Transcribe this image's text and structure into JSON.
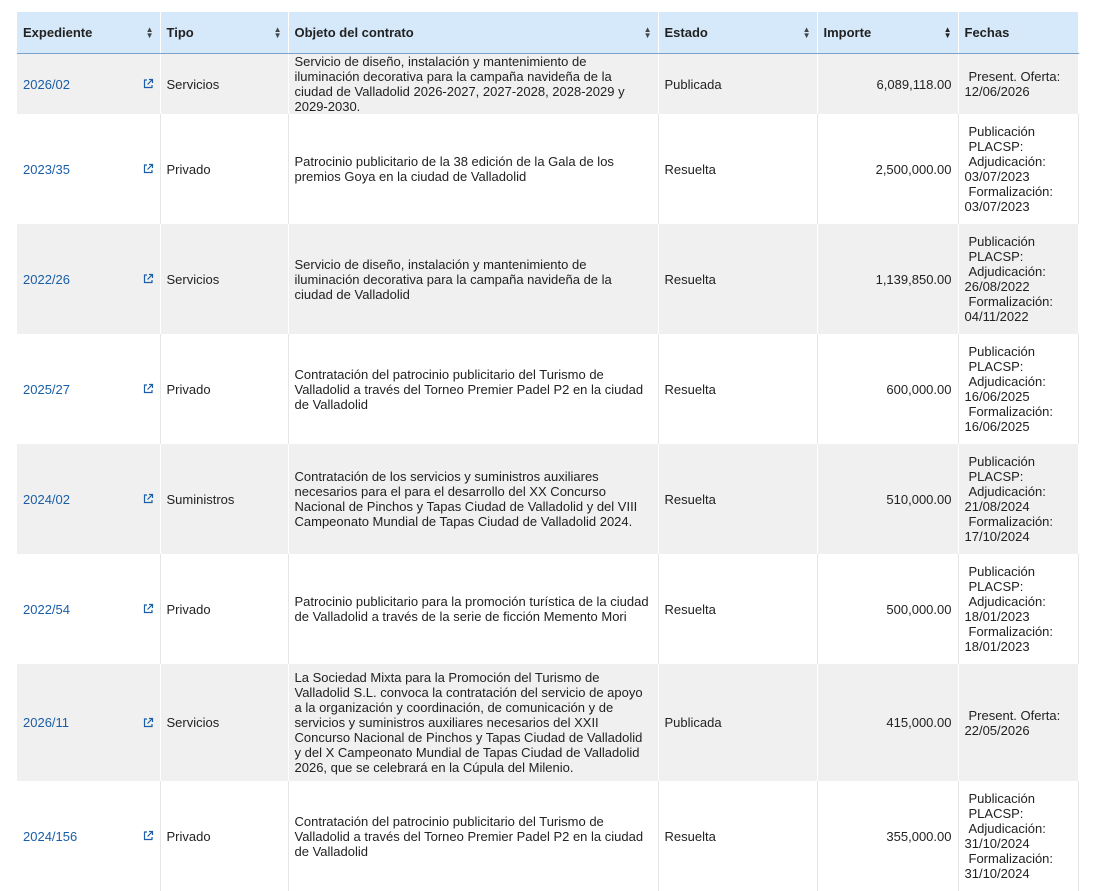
{
  "columns": [
    {
      "label": "Expediente",
      "sort": "both"
    },
    {
      "label": "Tipo",
      "sort": "both"
    },
    {
      "label": "Objeto del contrato",
      "sort": "both"
    },
    {
      "label": "Estado",
      "sort": "both"
    },
    {
      "label": "Importe",
      "sort": "desc"
    },
    {
      "label": "Fechas",
      "sort": "none"
    }
  ],
  "colors": {
    "header_bg": "#d6e9fa",
    "link": "#1a5ea8",
    "row_alt": "#f0f0f0"
  },
  "rows": [
    {
      "expediente": "2026/02",
      "tipo": "Servicios",
      "objeto": "Servicio de diseño, instalación y mantenimiento de iluminación decorativa para la campaña navideña de la ciudad de Valladolid 2026-2027, 2027-2028, 2028-2029 y 2029-2030.",
      "estado": "Publicada",
      "importe": "6,089,118.00",
      "fechas": [
        {
          "label": "Present. Oferta:",
          "value": "12/06/2026"
        }
      ]
    },
    {
      "expediente": "2023/35",
      "tipo": "Privado",
      "objeto": "Patrocinio publicitario de la 38 edición de la Gala de los premios Goya en la ciudad de Valladolid",
      "estado": "Resuelta",
      "importe": "2,500,000.00",
      "fechas": [
        {
          "label": "Publicación PLACSP:",
          "value": ""
        },
        {
          "label": "Adjudicación:",
          "value": "03/07/2023"
        },
        {
          "label": "Formalización:",
          "value": "03/07/2023"
        }
      ]
    },
    {
      "expediente": "2022/26",
      "tipo": "Servicios",
      "objeto": "Servicio de diseño, instalación y mantenimiento de iluminación decorativa para la campaña navideña de la ciudad de Valladolid",
      "estado": "Resuelta",
      "importe": "1,139,850.00",
      "fechas": [
        {
          "label": "Publicación PLACSP:",
          "value": ""
        },
        {
          "label": "Adjudicación:",
          "value": "26/08/2022"
        },
        {
          "label": "Formalización:",
          "value": "04/11/2022"
        }
      ]
    },
    {
      "expediente": "2025/27",
      "tipo": "Privado",
      "objeto": "Contratación del patrocinio publicitario del Turismo de Valladolid a través del Torneo Premier Padel P2 en la ciudad de Valladolid",
      "estado": "Resuelta",
      "importe": "600,000.00",
      "fechas": [
        {
          "label": "Publicación PLACSP:",
          "value": ""
        },
        {
          "label": "Adjudicación:",
          "value": "16/06/2025"
        },
        {
          "label": "Formalización:",
          "value": "16/06/2025"
        }
      ]
    },
    {
      "expediente": "2024/02",
      "tipo": "Suministros",
      "objeto": "Contratación de los servicios y suministros auxiliares necesarios para el para el desarrollo del XX Concurso Nacional de Pinchos y Tapas Ciudad de Valladolid y del VIII Campeonato Mundial de Tapas Ciudad de Valladolid 2024.",
      "estado": "Resuelta",
      "importe": "510,000.00",
      "fechas": [
        {
          "label": "Publicación PLACSP:",
          "value": ""
        },
        {
          "label": "Adjudicación:",
          "value": "21/08/2024"
        },
        {
          "label": "Formalización:",
          "value": "17/10/2024"
        }
      ]
    },
    {
      "expediente": "2022/54",
      "tipo": "Privado",
      "objeto": "Patrocinio publicitario para la promoción turística de la ciudad de Valladolid a través de la serie de ficción Memento Mori",
      "estado": "Resuelta",
      "importe": "500,000.00",
      "fechas": [
        {
          "label": "Publicación PLACSP:",
          "value": ""
        },
        {
          "label": "Adjudicación:",
          "value": "18/01/2023"
        },
        {
          "label": "Formalización:",
          "value": "18/01/2023"
        }
      ]
    },
    {
      "expediente": "2026/11",
      "tipo": "Servicios",
      "objeto": "La Sociedad Mixta para la Promoción del Turismo de Valladolid S.L. convoca la contratación del servicio de apoyo a la organización y coordinación, de comunicación y de servicios y suministros auxiliares necesarios del XXII Concurso Nacional de Pinchos y Tapas Ciudad de Valladolid y del X Campeonato Mundial de Tapas Ciudad de Valladolid 2026, que se celebrará en la Cúpula del Milenio.",
      "estado": "Publicada",
      "importe": "415,000.00",
      "fechas": [
        {
          "label": "Present. Oferta:",
          "value": "22/05/2026"
        }
      ]
    },
    {
      "expediente": "2024/156",
      "tipo": "Privado",
      "objeto": "Contratación del patrocinio publicitario del Turismo de Valladolid a través del Torneo Premier Padel P2 en la ciudad de Valladolid",
      "estado": "Resuelta",
      "importe": "355,000.00",
      "fechas": [
        {
          "label": "Publicación PLACSP:",
          "value": ""
        },
        {
          "label": "Adjudicación:",
          "value": "31/10/2024"
        },
        {
          "label": "Formalización:",
          "value": "31/10/2024"
        }
      ]
    }
  ]
}
